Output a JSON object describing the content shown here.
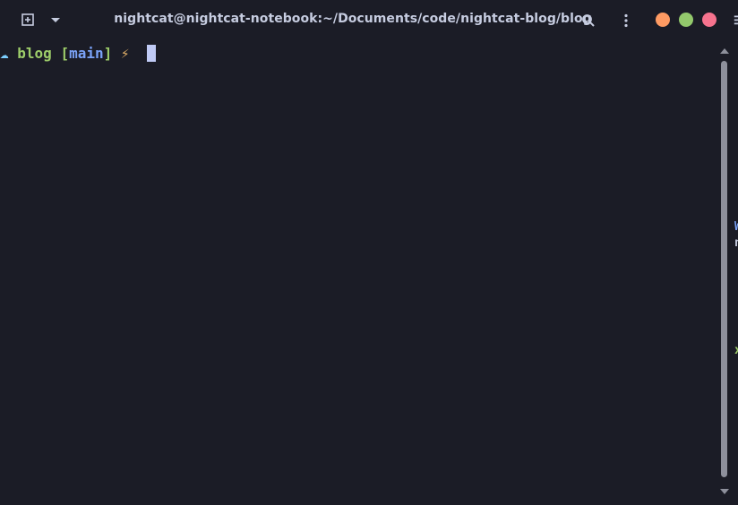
{
  "window": {
    "title": "nightcat@nightcat-notebook:~/Documents/code/nightcat-blog/blog",
    "background": "#1b1c26"
  },
  "titlebar": {
    "icons": [
      "new-tab-icon",
      "chevron-down-icon",
      "search-icon",
      "kebab-menu-icon"
    ],
    "window_controls": {
      "minimize_color": "#ff9b63",
      "maximize_color": "#93c96c",
      "close_color": "#f7738e"
    }
  },
  "terminal": {
    "prompt": {
      "symbol": "☁",
      "directory": "blog",
      "branch_open": "[",
      "branch": "main",
      "branch_close": "]",
      "status_symbol": "⚡"
    },
    "colors": {
      "symbol": "#7dcfff",
      "directory": "#9ece6a",
      "branch": "#7aa2f7",
      "bracket": "#9ece6a",
      "status": "#e0af68",
      "cursor": "#c0caf5"
    }
  },
  "edge_glyphs": {
    "top": "☰",
    "middle_1": "W",
    "middle_2": "n",
    "lower": "x"
  }
}
